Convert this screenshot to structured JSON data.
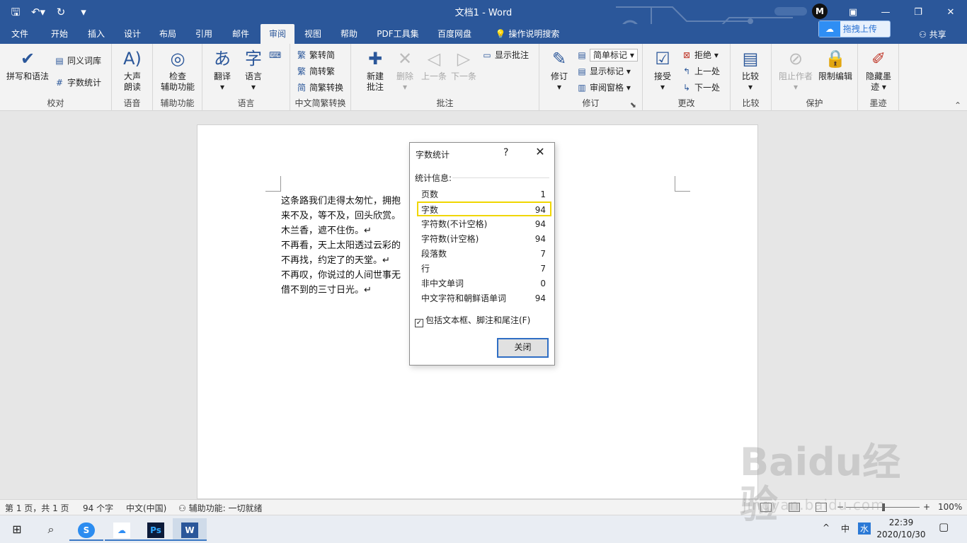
{
  "window": {
    "title": "文档1  -  Word",
    "user_initial": "M",
    "upload_label": "拖拽上传",
    "share_label": "共享"
  },
  "tabs": [
    "文件",
    "开始",
    "插入",
    "设计",
    "布局",
    "引用",
    "邮件",
    "审阅",
    "视图",
    "帮助",
    "PDF工具集",
    "百度网盘",
    "操作说明搜索"
  ],
  "active_tab": "审阅",
  "ribbon": {
    "proofing": {
      "spell": "拼写和语法",
      "thesaurus": "同义词库",
      "wordcount": "字数统计",
      "label": "校对"
    },
    "speech": {
      "readaloud_1": "大声",
      "readaloud_2": "朗读",
      "label": "语音"
    },
    "accessibility": {
      "check_1": "检查",
      "check_2": "辅助功能",
      "label": "辅助功能"
    },
    "language": {
      "translate": "翻译",
      "language": "语言",
      "label": "语言"
    },
    "chinese": {
      "t2s": "繁转简",
      "s2t": "简转繁",
      "convert": "简繁转换",
      "label": "中文简繁转换"
    },
    "comments": {
      "new_1": "新建",
      "new_2": "批注",
      "delete": "删除",
      "prev": "上一条",
      "next": "下一条",
      "show": "显示批注",
      "label": "批注"
    },
    "tracking": {
      "track": "修订",
      "markup": "简单标记",
      "showmarkup": "显示标记",
      "pane": "审阅窗格",
      "label": "修订"
    },
    "changes": {
      "accept": "接受",
      "reject": "拒绝",
      "prev": "上一处",
      "next": "下一处",
      "label": "更改"
    },
    "compare": {
      "compare": "比较",
      "label": "比较"
    },
    "protect": {
      "block": "阻止作者",
      "restrict": "限制编辑",
      "label": "保护"
    },
    "ink": {
      "hide_1": "隐藏墨",
      "hide_2": "迹",
      "label": "墨迹"
    }
  },
  "document": {
    "lines": [
      "这条路我们走得太匆忙，拥抱",
      "来不及，等不及，回头欣赏。",
      "木兰香，遮不住伤。↵",
      "不再看，天上太阳透过云彩的",
      "不再找，约定了的天堂。↵",
      "不再叹，你说过的人间世事无",
      "借不到的三寸日光。↵"
    ]
  },
  "dialog": {
    "title": "字数统计",
    "help": "?",
    "close_x": "✕",
    "section": "统计信息:",
    "stats": [
      {
        "label": "页数",
        "value": "1"
      },
      {
        "label": "字数",
        "value": "94"
      },
      {
        "label": "字符数(不计空格)",
        "value": "94"
      },
      {
        "label": "字符数(计空格)",
        "value": "94"
      },
      {
        "label": "段落数",
        "value": "7"
      },
      {
        "label": "行",
        "value": "7"
      },
      {
        "label": "非中文单词",
        "value": "0"
      },
      {
        "label": "中文字符和朝鲜语单词",
        "value": "94"
      }
    ],
    "highlighted_row": "字数",
    "checkbox_label": "包括文本框、脚注和尾注(F)",
    "checkbox_checked": true,
    "close_button": "关闭"
  },
  "statusbar": {
    "page": "第 1 页，共 1 页",
    "words": "94 个字",
    "language": "中文(中国)",
    "accessibility": "辅助功能: 一切就绪",
    "zoom_minus": "−",
    "zoom_plus": "+",
    "zoom": "100%"
  },
  "taskbar": {
    "time": "22:39",
    "date": "2020/10/30",
    "ime": "中",
    "chevron": "^"
  },
  "watermark": {
    "brand": "Baidu经验",
    "url": "jingyan.baidu.com"
  },
  "colors": {
    "word_blue": "#2b579a",
    "highlight": "#f0d600",
    "button_focus": "#2f6ec4"
  }
}
